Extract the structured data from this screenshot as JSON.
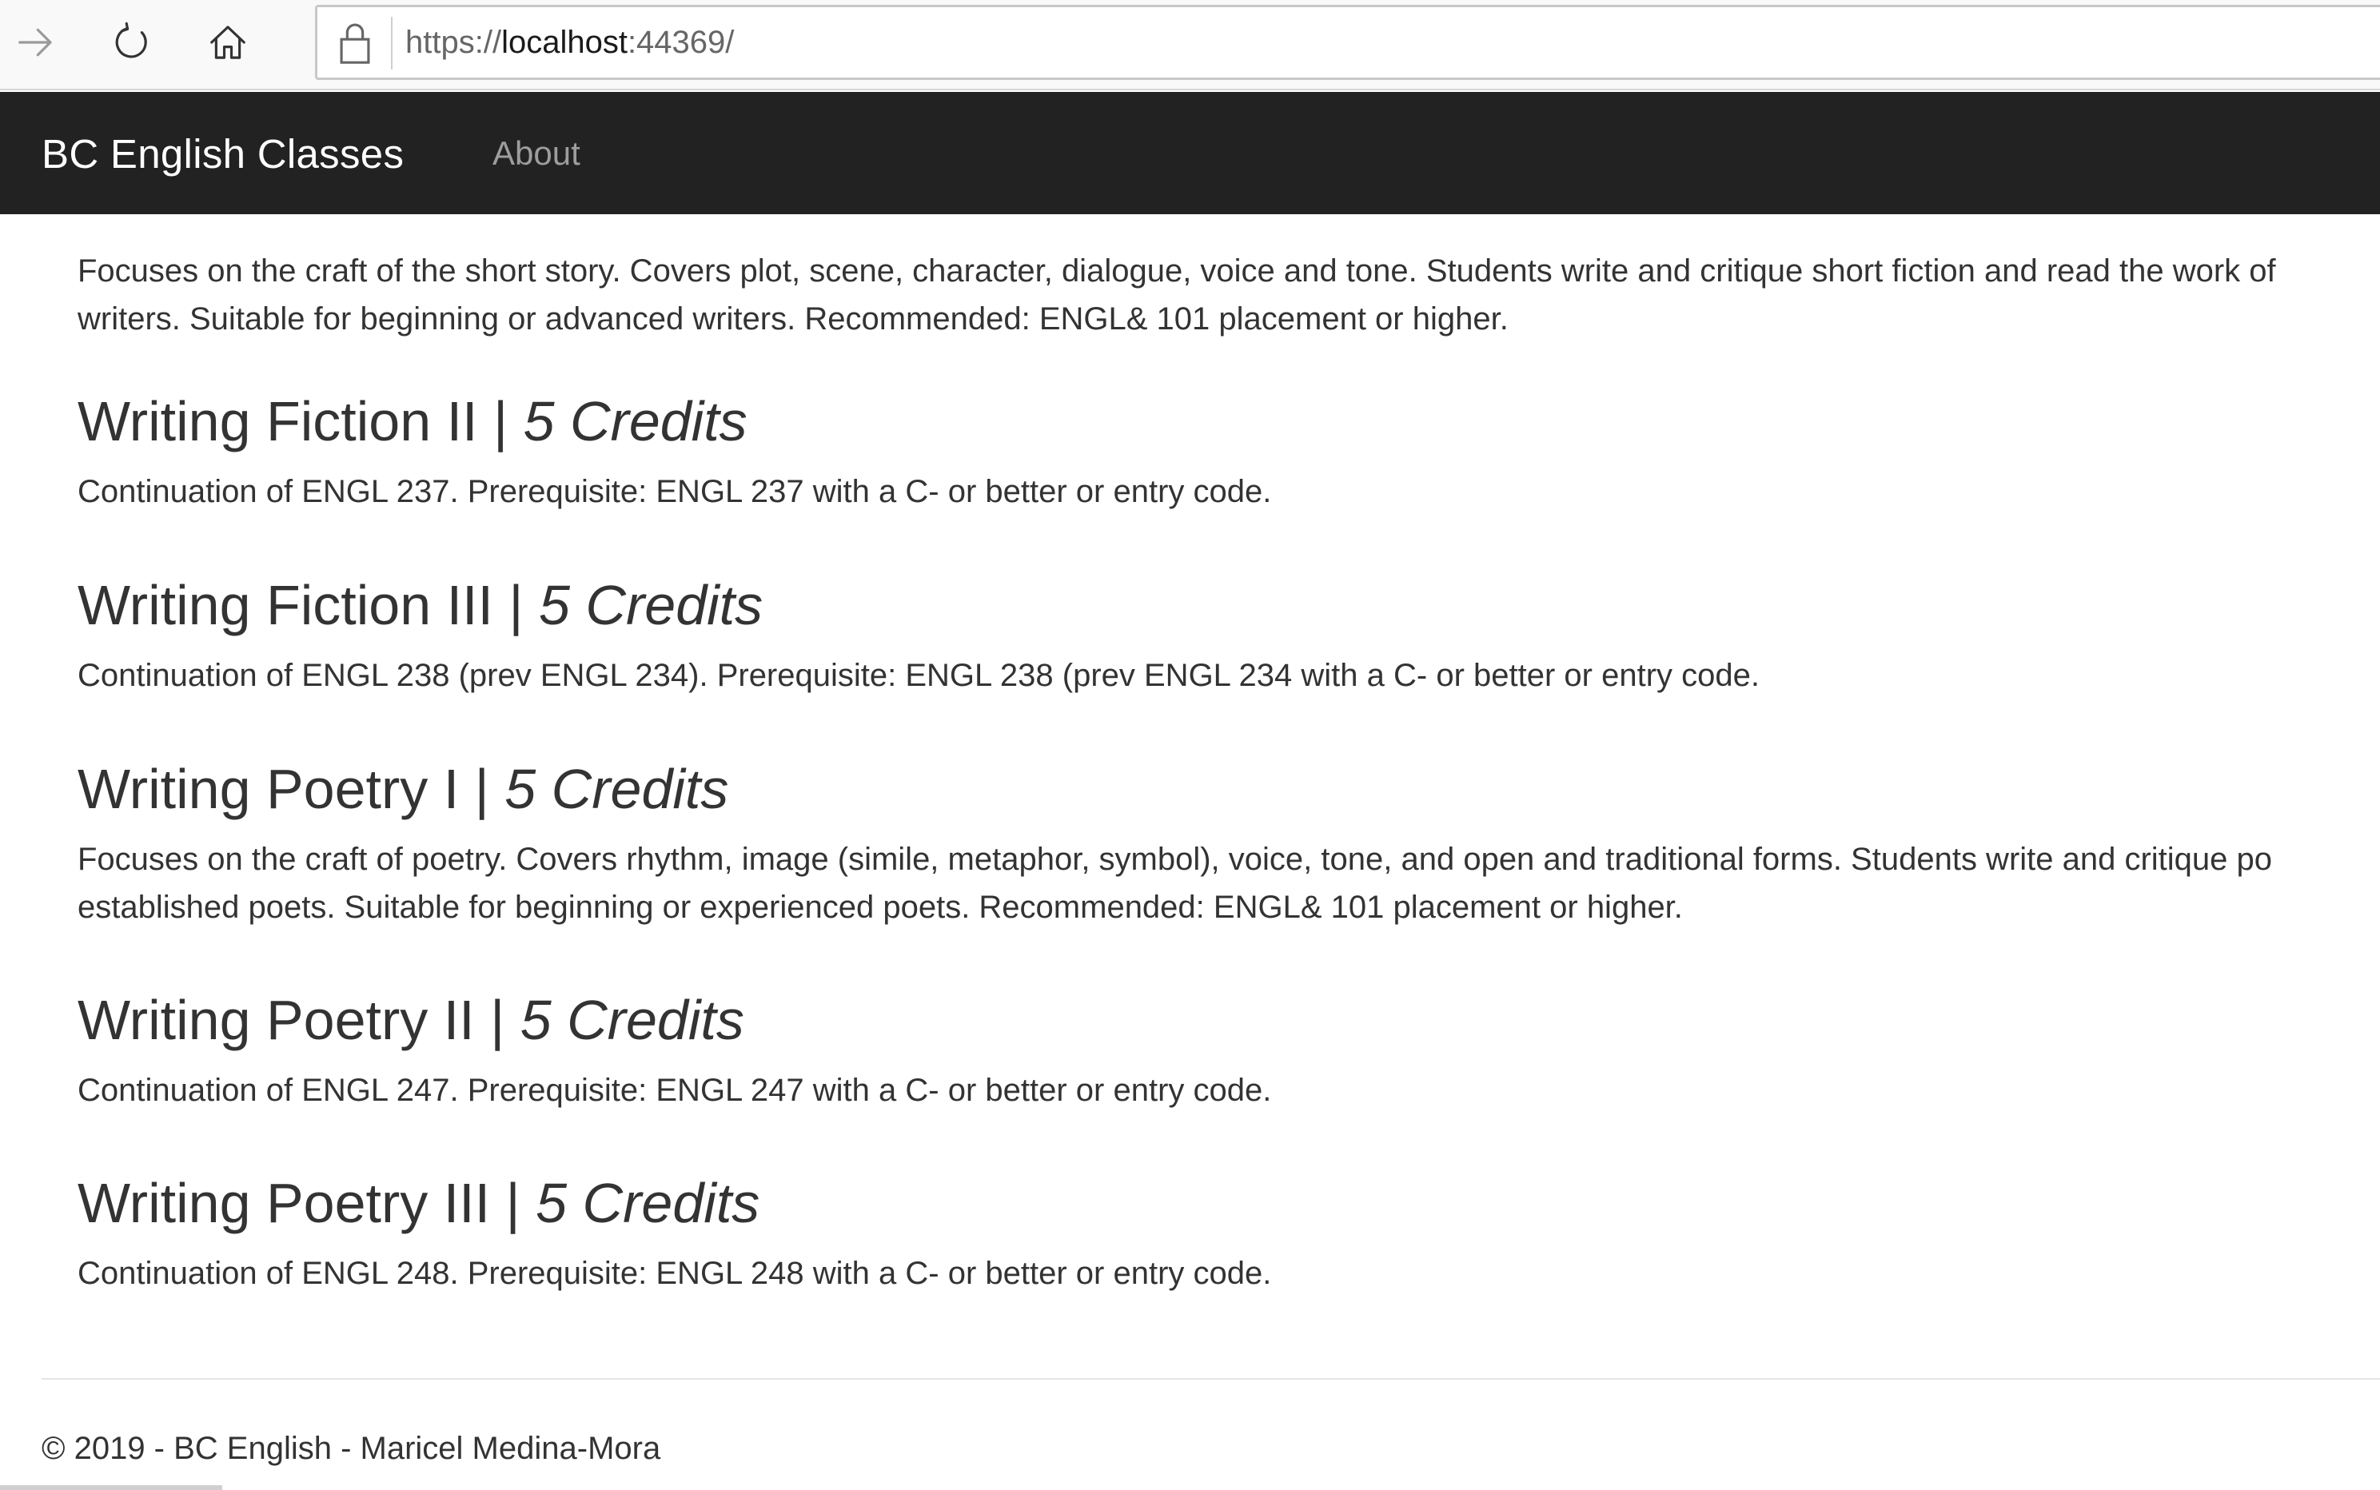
{
  "browser": {
    "url_scheme": "https://",
    "url_host": "localhost",
    "url_rest": ":44369/",
    "icons": [
      "forward-arrow-icon",
      "refresh-icon",
      "home-icon",
      "lock-icon"
    ]
  },
  "navbar": {
    "brand": "BC English Classes",
    "about_label": "About",
    "background": "#222222",
    "link_color": "#9d9d9d"
  },
  "content": {
    "partial_course_desc_line1": "Focuses on the craft of the short story. Covers plot, scene, character, dialogue, voice and tone. Students write and critique short fiction and read the work of",
    "partial_course_desc_line2": "writers. Suitable for beginning or advanced writers. Recommended: ENGL& 101 placement or higher.",
    "courses": [
      {
        "title": "Writing Fiction II | ",
        "credits": "5 Credits",
        "desc_line1": "Continuation of ENGL 237. Prerequisite: ENGL 237 with a C- or better or entry code.",
        "desc_line2": ""
      },
      {
        "title": "Writing Fiction III | ",
        "credits": "5 Credits",
        "desc_line1": "Continuation of ENGL 238 (prev ENGL 234). Prerequisite: ENGL 238 (prev ENGL 234 with a C- or better or entry code.",
        "desc_line2": ""
      },
      {
        "title": "Writing Poetry I | ",
        "credits": "5 Credits",
        "desc_line1": "Focuses on the craft of poetry. Covers rhythm, image (simile, metaphor, symbol), voice, tone, and open and traditional forms. Students write and critique po",
        "desc_line2": "established poets. Suitable for beginning or experienced poets. Recommended: ENGL& 101 placement or higher."
      },
      {
        "title": "Writing Poetry II | ",
        "credits": "5 Credits",
        "desc_line1": "Continuation of ENGL 247. Prerequisite: ENGL 247 with a C- or better or entry code.",
        "desc_line2": ""
      },
      {
        "title": "Writing Poetry III | ",
        "credits": "5 Credits",
        "desc_line1": "Continuation of ENGL 248. Prerequisite: ENGL 248 with a C- or better or entry code.",
        "desc_line2": ""
      }
    ]
  },
  "footer": {
    "text": "© 2019 - BC English - Maricel Medina-Mora"
  }
}
